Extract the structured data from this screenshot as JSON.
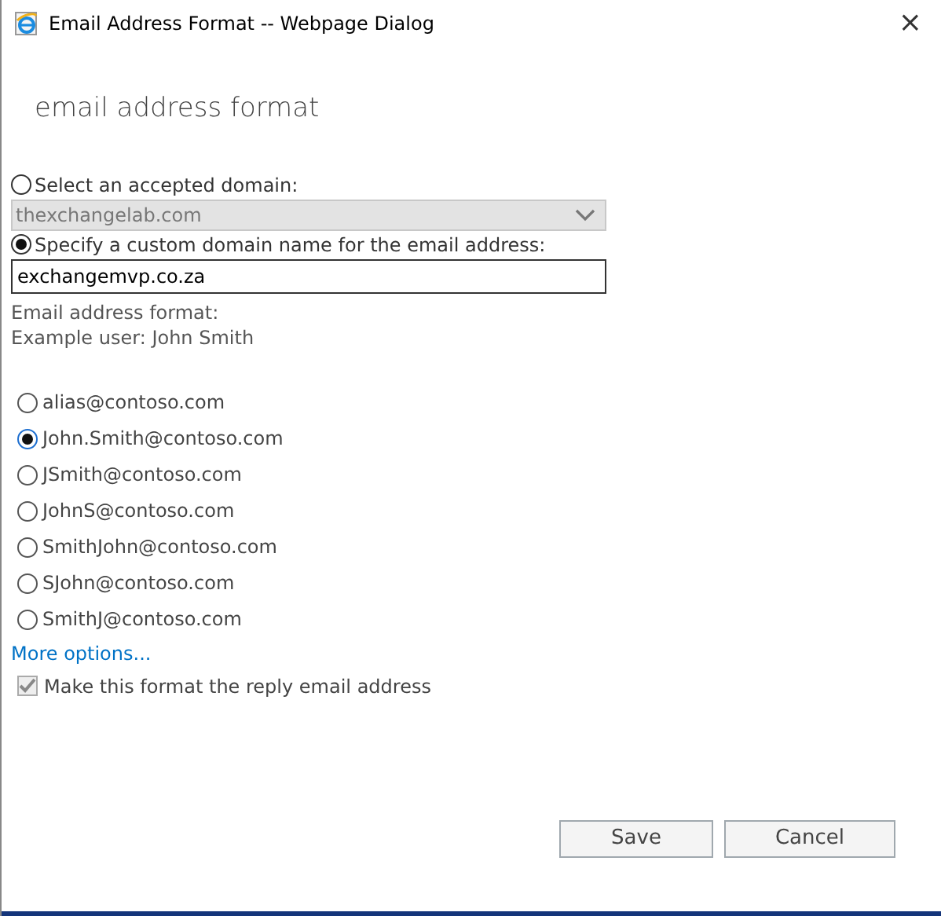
{
  "window": {
    "title": "Email Address Format -- Webpage Dialog",
    "close": "×"
  },
  "heading": "email address format",
  "domain_options": [
    {
      "label": "Select an accepted domain:",
      "selected": false,
      "kind": "dropdown",
      "value": "thexchangelab.com",
      "disabled": true
    },
    {
      "label": "Specify a custom domain name for the email address:",
      "selected": true,
      "kind": "text",
      "value": "exchangemvp.co.za",
      "disabled": false
    }
  ],
  "format_label": "Email address format:",
  "example_user": "Example user: John Smith",
  "formats": [
    {
      "label": "alias@contoso.com",
      "selected": false
    },
    {
      "label": "John.Smith@contoso.com",
      "selected": true
    },
    {
      "label": "JSmith@contoso.com",
      "selected": false
    },
    {
      "label": "JohnS@contoso.com",
      "selected": false
    },
    {
      "label": "SmithJohn@contoso.com",
      "selected": false
    },
    {
      "label": "SJohn@contoso.com",
      "selected": false
    },
    {
      "label": "SmithJ@contoso.com",
      "selected": false
    }
  ],
  "more_options": "More options...",
  "reply_checkbox": {
    "label": "Make this format the reply email address",
    "checked": true,
    "disabled": true
  },
  "buttons": [
    "Save",
    "Cancel"
  ]
}
